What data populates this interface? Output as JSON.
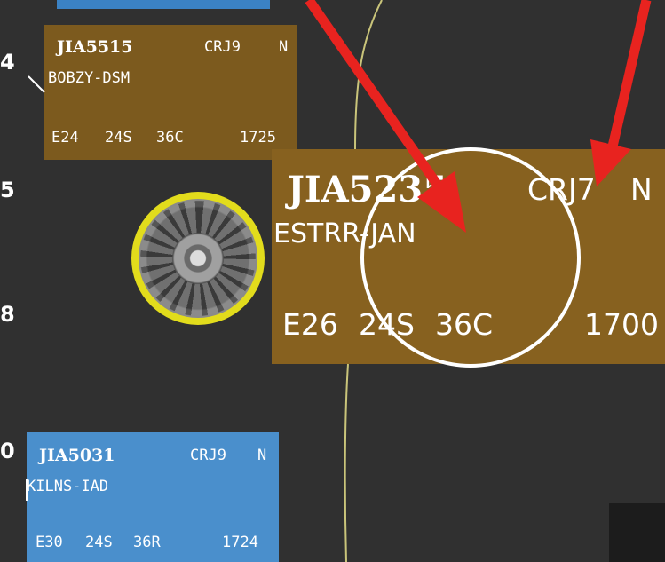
{
  "edge_labels": {
    "top": "4",
    "middle": "5",
    "lower": "8",
    "bottom": "0"
  },
  "tags": {
    "jia5515": {
      "callsign": "JIA5515",
      "aircraft": "CRJ9",
      "flag": "N",
      "route": "BOBZY-DSM",
      "fix": "E24",
      "alt": "24S",
      "runway": "36C",
      "time": "1725",
      "color": "#7c5a1e"
    },
    "jia5235": {
      "callsign": "JIA5235",
      "aircraft": "CRJ7",
      "flag": "N",
      "route": "ESTRR-JAN",
      "fix": "E26",
      "alt": "24S",
      "runway": "36C",
      "time": "1700",
      "color": "#87611f"
    },
    "jia5031": {
      "callsign": "JIA5031",
      "aircraft": "CRJ9",
      "flag": "N",
      "route": "KILNS-IAD",
      "fix": "E30",
      "alt": "24S",
      "runway": "36R",
      "time": "1724",
      "color": "#4a8fcc"
    }
  },
  "annotations": {
    "arrow_color": "#e8231f",
    "circle_color": "#ffffff",
    "target_ring_color": "#e2dc1c"
  }
}
